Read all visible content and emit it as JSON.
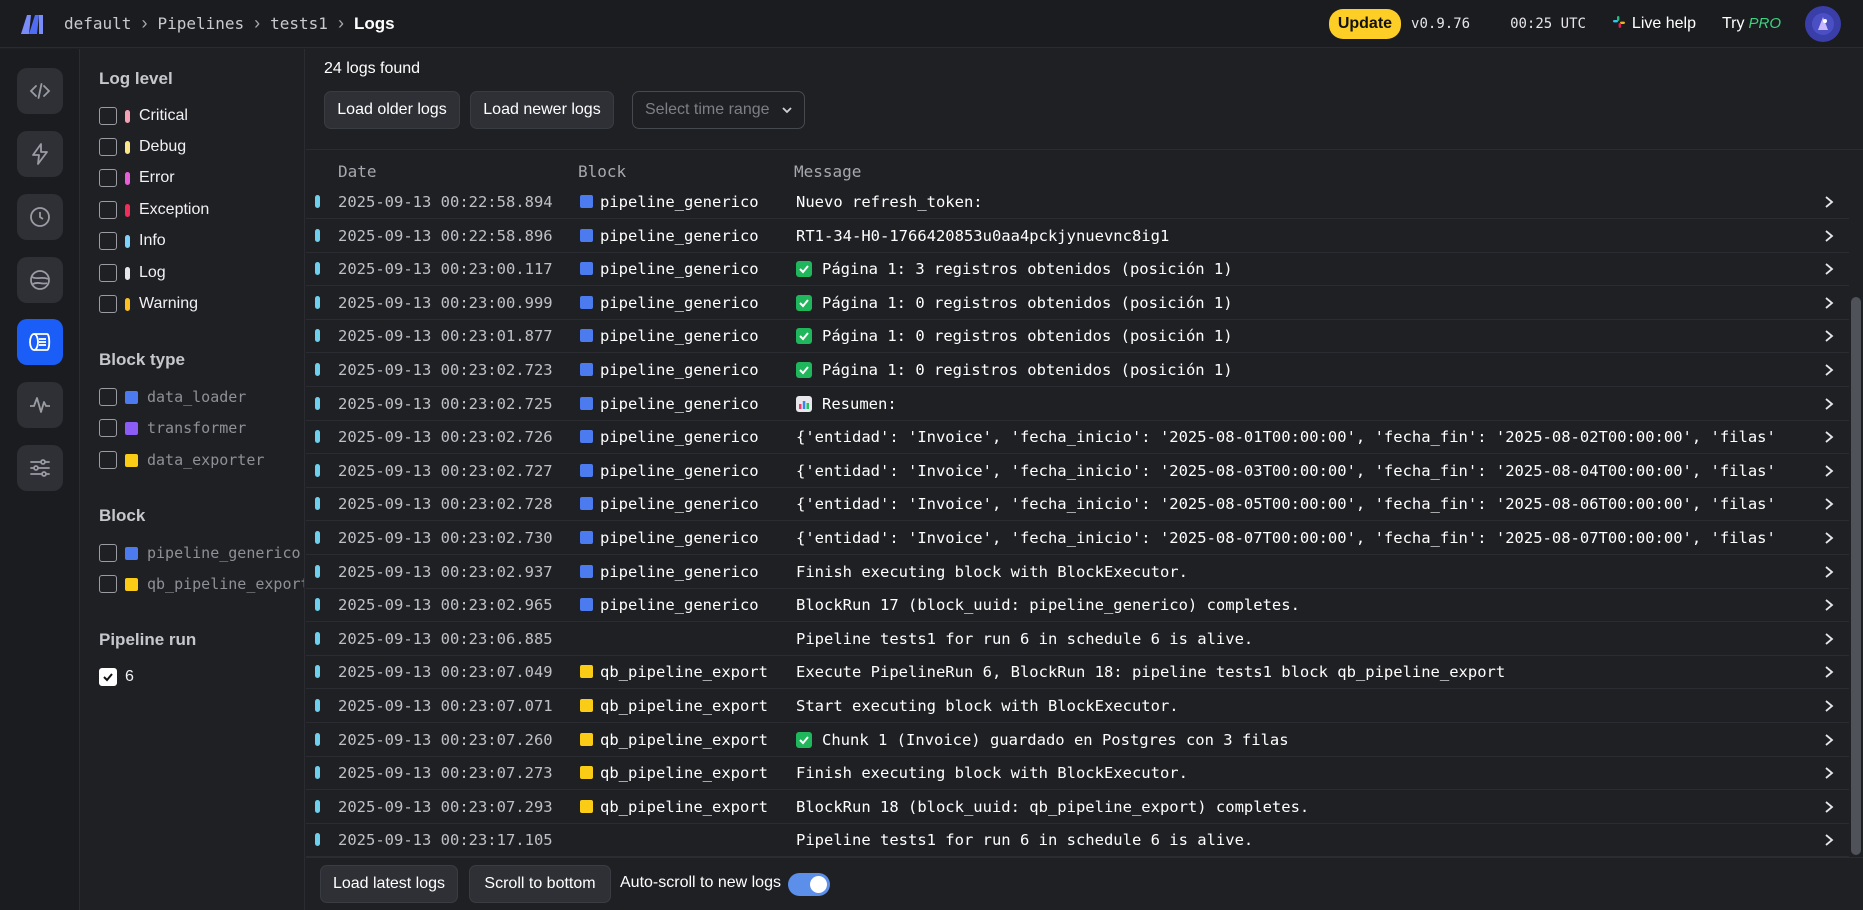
{
  "header": {
    "breadcrumb": [
      "default",
      "Pipelines",
      "tests1",
      "Logs"
    ],
    "update_label": "Update",
    "version": "v0.9.76",
    "clock": "00:25 UTC",
    "live_help": "Live help",
    "try_label": "Try",
    "pro_label": "PRO"
  },
  "rail": {
    "items": [
      {
        "icon": "code-icon",
        "active": false
      },
      {
        "icon": "lightning-icon",
        "active": false
      },
      {
        "icon": "clock-icon",
        "active": false
      },
      {
        "icon": "globe-icon",
        "active": false
      },
      {
        "icon": "logs-icon",
        "active": true
      },
      {
        "icon": "monitor-icon",
        "active": false
      },
      {
        "icon": "settings-sliders-icon",
        "active": false
      }
    ]
  },
  "filters": {
    "log_level": {
      "title": "Log level",
      "items": [
        {
          "label": "Critical",
          "color": "#f5a0b4",
          "checked": false
        },
        {
          "label": "Debug",
          "color": "#fde68a",
          "checked": false
        },
        {
          "label": "Error",
          "color": "#e65fd9",
          "checked": false
        },
        {
          "label": "Exception",
          "color": "#ef2f5a",
          "checked": false
        },
        {
          "label": "Info",
          "color": "#7dd3fc",
          "checked": false
        },
        {
          "label": "Log",
          "color": "#e5e7eb",
          "checked": false
        },
        {
          "label": "Warning",
          "color": "#fbbf24",
          "checked": false
        }
      ]
    },
    "block_type": {
      "title": "Block type",
      "items": [
        {
          "label": "data_loader",
          "color": "#4b7bef",
          "checked": false
        },
        {
          "label": "transformer",
          "color": "#8b5cf6",
          "checked": false
        },
        {
          "label": "data_exporter",
          "color": "#facc15",
          "checked": false
        }
      ]
    },
    "block": {
      "title": "Block",
      "items": [
        {
          "label": "pipeline_generico",
          "color": "#4b7bef",
          "checked": false
        },
        {
          "label": "qb_pipeline_export",
          "color": "#facc15",
          "checked": false
        }
      ]
    },
    "pipeline_run": {
      "title": "Pipeline run",
      "items": [
        {
          "label": "6",
          "checked": true
        }
      ]
    }
  },
  "main": {
    "logs_count": "24 logs found",
    "load_older": "Load older logs",
    "load_newer": "Load newer logs",
    "time_range_placeholder": "Select time range",
    "columns": {
      "date": "Date",
      "block": "Block",
      "message": "Message"
    },
    "block_colors": {
      "pipeline_generico": "#4b7bef",
      "qb_pipeline_export": "#facc15"
    },
    "rows": [
      {
        "date": "2025-09-13 00:22:58.894",
        "block": "pipeline_generico",
        "emoji": "",
        "message": "Nuevo refresh_token:"
      },
      {
        "date": "2025-09-13 00:22:58.896",
        "block": "pipeline_generico",
        "emoji": "",
        "message": "RT1-34-H0-1766420853u0aa4pckjynuevnc8ig1"
      },
      {
        "date": "2025-09-13 00:23:00.117",
        "block": "pipeline_generico",
        "emoji": "check",
        "message": "Página 1: 3 registros obtenidos (posición 1)"
      },
      {
        "date": "2025-09-13 00:23:00.999",
        "block": "pipeline_generico",
        "emoji": "check",
        "message": "Página 1: 0 registros obtenidos (posición 1)"
      },
      {
        "date": "2025-09-13 00:23:01.877",
        "block": "pipeline_generico",
        "emoji": "check",
        "message": "Página 1: 0 registros obtenidos (posición 1)"
      },
      {
        "date": "2025-09-13 00:23:02.723",
        "block": "pipeline_generico",
        "emoji": "check",
        "message": "Página 1: 0 registros obtenidos (posición 1)"
      },
      {
        "date": "2025-09-13 00:23:02.725",
        "block": "pipeline_generico",
        "emoji": "chart",
        "message": "Resumen:"
      },
      {
        "date": "2025-09-13 00:23:02.726",
        "block": "pipeline_generico",
        "emoji": "",
        "message": "{'entidad': 'Invoice', 'fecha_inicio': '2025-08-01T00:00:00', 'fecha_fin': '2025-08-02T00:00:00', 'filas'"
      },
      {
        "date": "2025-09-13 00:23:02.727",
        "block": "pipeline_generico",
        "emoji": "",
        "message": "{'entidad': 'Invoice', 'fecha_inicio': '2025-08-03T00:00:00', 'fecha_fin': '2025-08-04T00:00:00', 'filas'"
      },
      {
        "date": "2025-09-13 00:23:02.728",
        "block": "pipeline_generico",
        "emoji": "",
        "message": "{'entidad': 'Invoice', 'fecha_inicio': '2025-08-05T00:00:00', 'fecha_fin': '2025-08-06T00:00:00', 'filas'"
      },
      {
        "date": "2025-09-13 00:23:02.730",
        "block": "pipeline_generico",
        "emoji": "",
        "message": "{'entidad': 'Invoice', 'fecha_inicio': '2025-08-07T00:00:00', 'fecha_fin': '2025-08-07T00:00:00', 'filas'"
      },
      {
        "date": "2025-09-13 00:23:02.937",
        "block": "pipeline_generico",
        "emoji": "",
        "message": "Finish executing block with BlockExecutor."
      },
      {
        "date": "2025-09-13 00:23:02.965",
        "block": "pipeline_generico",
        "emoji": "",
        "message": "BlockRun 17 (block_uuid: pipeline_generico) completes."
      },
      {
        "date": "2025-09-13 00:23:06.885",
        "block": "",
        "emoji": "",
        "message": "Pipeline tests1 for run 6 in schedule 6 is alive."
      },
      {
        "date": "2025-09-13 00:23:07.049",
        "block": "qb_pipeline_export",
        "emoji": "",
        "message": "Execute PipelineRun 6, BlockRun 18: pipeline tests1 block qb_pipeline_export"
      },
      {
        "date": "2025-09-13 00:23:07.071",
        "block": "qb_pipeline_export",
        "emoji": "",
        "message": "Start executing block with BlockExecutor."
      },
      {
        "date": "2025-09-13 00:23:07.260",
        "block": "qb_pipeline_export",
        "emoji": "check",
        "message": "Chunk 1 (Invoice) guardado en Postgres con 3 filas"
      },
      {
        "date": "2025-09-13 00:23:07.273",
        "block": "qb_pipeline_export",
        "emoji": "",
        "message": "Finish executing block with BlockExecutor."
      },
      {
        "date": "2025-09-13 00:23:07.293",
        "block": "qb_pipeline_export",
        "emoji": "",
        "message": "BlockRun 18 (block_uuid: qb_pipeline_export) completes."
      },
      {
        "date": "2025-09-13 00:23:17.105",
        "block": "",
        "emoji": "",
        "message": "Pipeline tests1 for run 6 in schedule 6 is alive."
      }
    ],
    "footer": {
      "load_latest": "Load latest logs",
      "scroll_bottom": "Scroll to bottom",
      "autoscroll_label": "Auto-scroll to new logs",
      "autoscroll_on": true
    }
  }
}
